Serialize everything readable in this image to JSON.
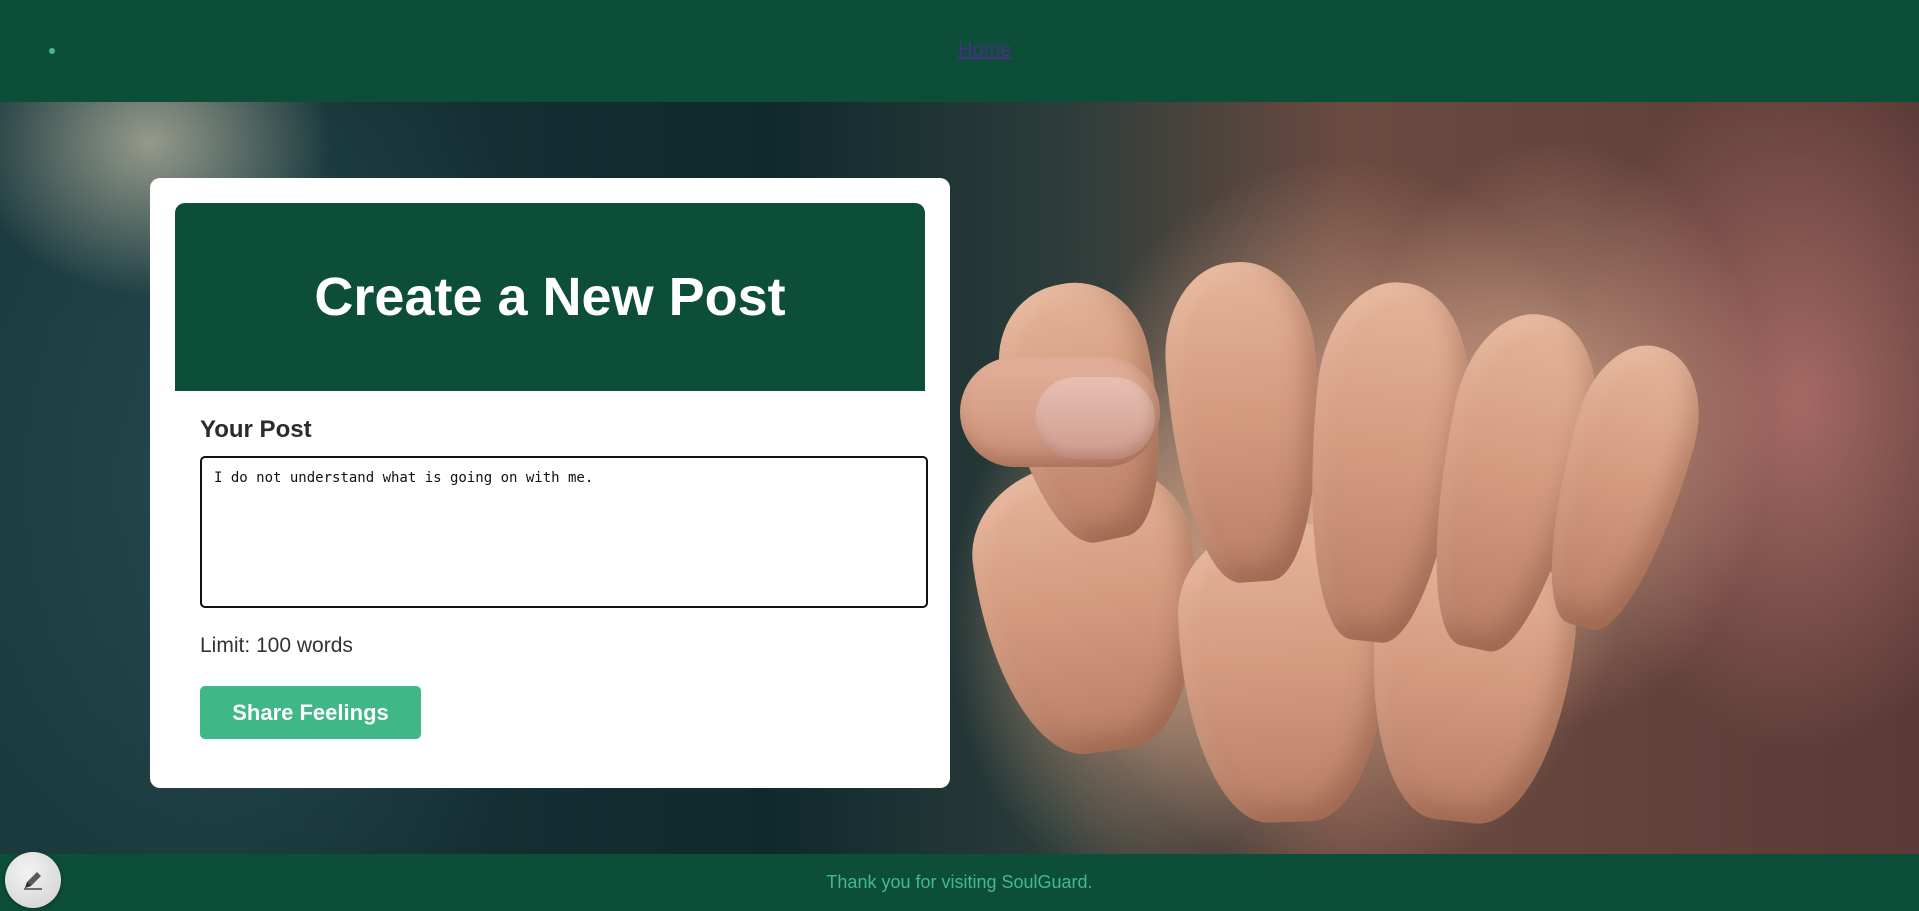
{
  "nav": {
    "home_label": "Home"
  },
  "card": {
    "title": "Create a New Post",
    "post_label": "Your Post",
    "post_value": "I do not understand what is going on with me.",
    "limit_text": "Limit: 100 words",
    "submit_label": "Share Feelings"
  },
  "footer": {
    "text": "Thank you for visiting SoulGuard."
  },
  "icons": {
    "edit_fab": "pencil-icon"
  },
  "colors": {
    "primary_dark_green": "#0c4e38",
    "accent_green": "#3fb787",
    "footer_text_green": "#46b98b",
    "link_purple": "#4a2f86"
  }
}
